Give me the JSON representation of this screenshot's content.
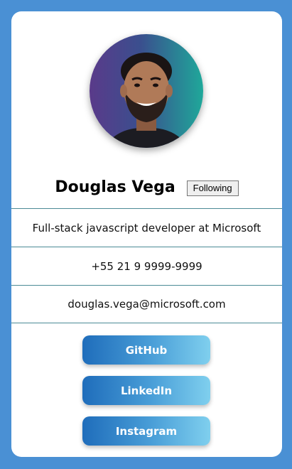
{
  "profile": {
    "name": "Douglas Vega",
    "follow_label": "Following",
    "bio": "Full-stack javascript developer at Microsoft",
    "phone": "+55 21 9 9999-9999",
    "email": "douglas.vega@microsoft.com"
  },
  "social": {
    "github": "GitHub",
    "linkedin": "LinkedIn",
    "instagram": "Instagram"
  },
  "colors": {
    "page_background": "#4a90d4",
    "card_background": "#ffffff",
    "divider": "#4b8a96",
    "button_gradient_start": "#1f6dbb",
    "button_gradient_end": "#7fcfee"
  }
}
